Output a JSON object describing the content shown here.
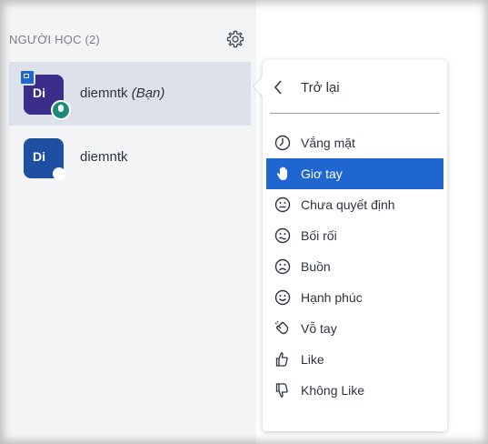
{
  "panel": {
    "title": "NGƯỜI HỌC (2)",
    "settings_icon": "gear-icon"
  },
  "users": [
    {
      "initials": "Di",
      "name": "diemntk",
      "you_label": "(Bạn)",
      "avatar_color": "#3b2e8a",
      "active": true
    },
    {
      "initials": "Di",
      "name": "diemntk",
      "you_label": "",
      "avatar_color": "#1e4fa3",
      "active": false
    }
  ],
  "status_menu": {
    "back_label": "Trở lại",
    "items": [
      {
        "label": "Vắng mặt",
        "icon": "clock-icon"
      },
      {
        "label": "Giơ tay",
        "icon": "raised-hand-icon",
        "selected": true
      },
      {
        "label": "Chưa quyết định",
        "icon": "neutral-face-icon"
      },
      {
        "label": "Bối rối",
        "icon": "confused-face-icon"
      },
      {
        "label": "Buồn",
        "icon": "sad-face-icon"
      },
      {
        "label": "Hạnh phúc",
        "icon": "happy-face-icon"
      },
      {
        "label": "Vỗ tay",
        "icon": "clapping-hands-icon"
      },
      {
        "label": "Like",
        "icon": "thumbs-up-icon"
      },
      {
        "label": "Không Like",
        "icon": "thumbs-down-icon"
      }
    ]
  },
  "colors": {
    "selected_bg": "#1f66d0",
    "active_row_bg": "#dde2ea",
    "text": "#2d3440"
  }
}
